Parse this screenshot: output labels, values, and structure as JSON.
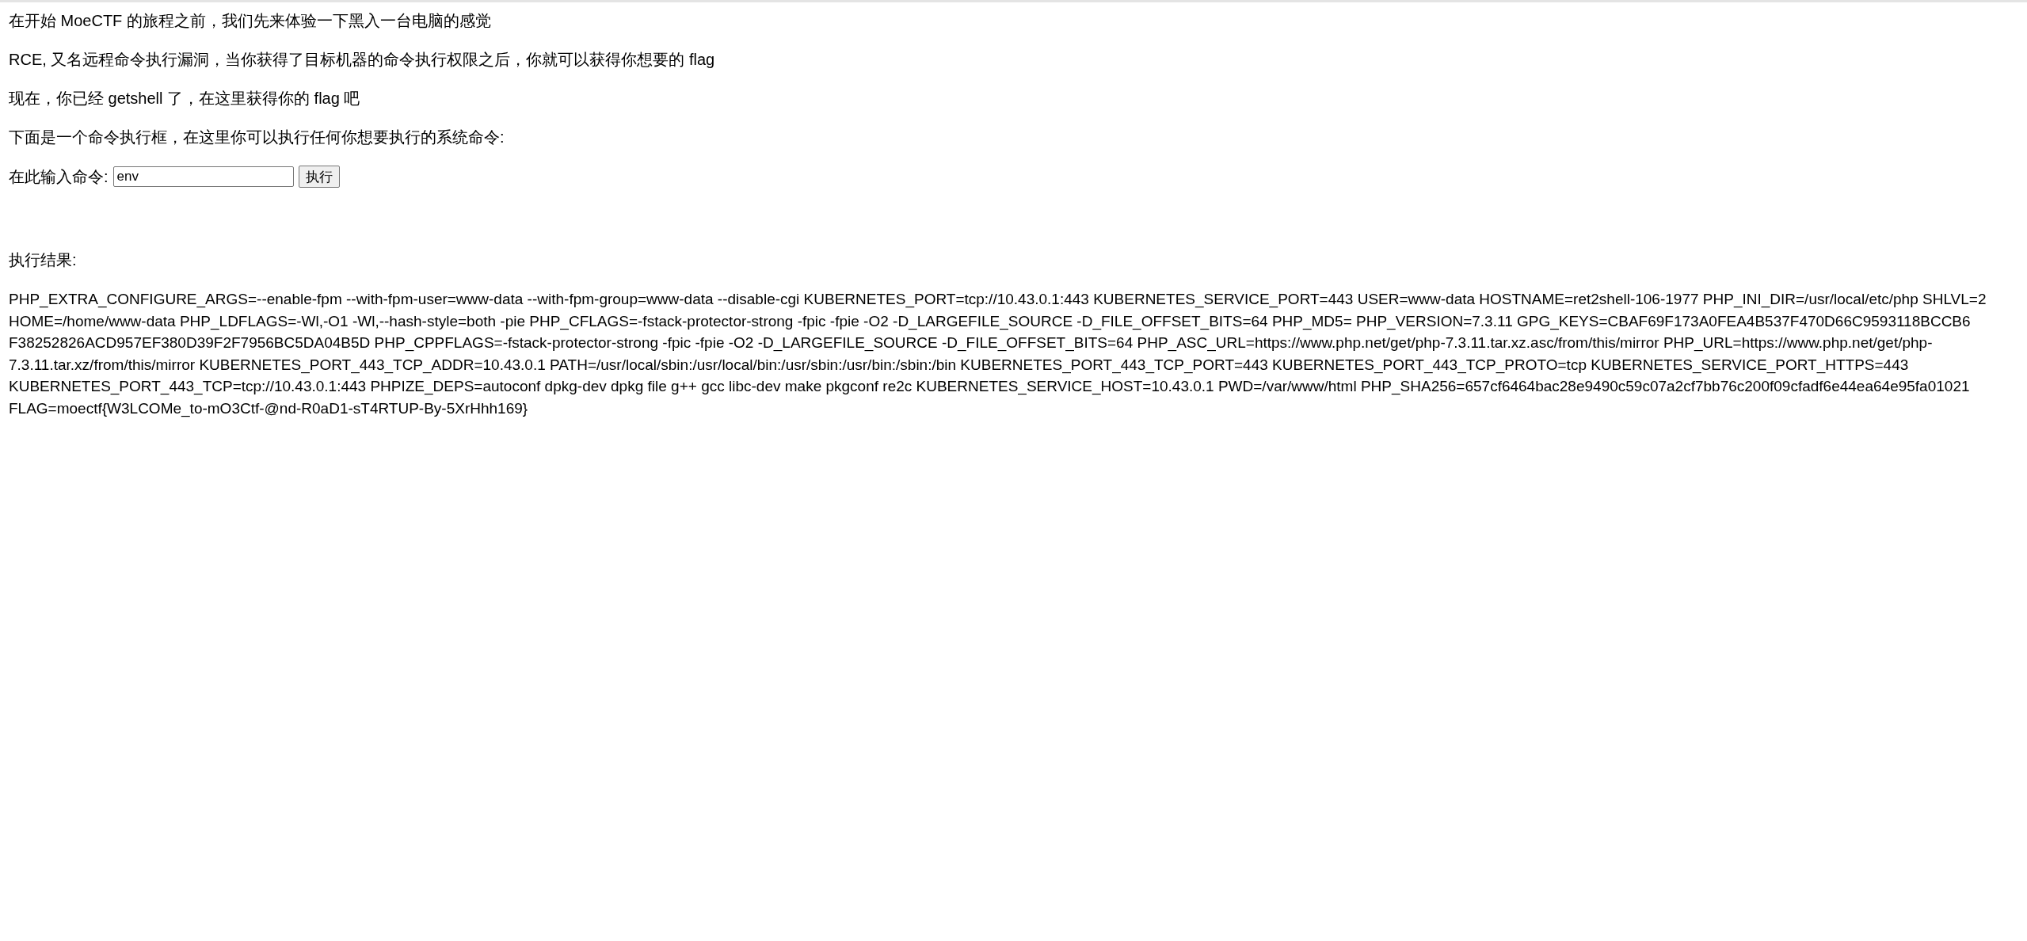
{
  "paragraphs": [
    "在开始 MoeCTF 的旅程之前，我们先来体验一下黑入一台电脑的感觉",
    "RCE, 又名远程命令执行漏洞，当你获得了目标机器的命令执行权限之后，你就可以获得你想要的 flag",
    "现在，你已经 getshell 了，在这里获得你的 flag 吧",
    "下面是一个命令执行框，在这里你可以执行任何你想要执行的系统命令:"
  ],
  "command_form": {
    "label": "在此输入命令:",
    "value": "env",
    "button": "执行"
  },
  "result": {
    "label": "执行结果:",
    "output": "PHP_EXTRA_CONFIGURE_ARGS=--enable-fpm --with-fpm-user=www-data --with-fpm-group=www-data --disable-cgi KUBERNETES_PORT=tcp://10.43.0.1:443 KUBERNETES_SERVICE_PORT=443 USER=www-data HOSTNAME=ret2shell-106-1977 PHP_INI_DIR=/usr/local/etc/php SHLVL=2 HOME=/home/www-data PHP_LDFLAGS=-Wl,-O1 -Wl,--hash-style=both -pie PHP_CFLAGS=-fstack-protector-strong -fpic -fpie -O2 -D_LARGEFILE_SOURCE -D_FILE_OFFSET_BITS=64 PHP_MD5= PHP_VERSION=7.3.11 GPG_KEYS=CBAF69F173A0FEA4B537F470D66C9593118BCCB6 F38252826ACD957EF380D39F2F7956BC5DA04B5D PHP_CPPFLAGS=-fstack-protector-strong -fpic -fpie -O2 -D_LARGEFILE_SOURCE -D_FILE_OFFSET_BITS=64 PHP_ASC_URL=https://www.php.net/get/php-7.3.11.tar.xz.asc/from/this/mirror PHP_URL=https://www.php.net/get/php-7.3.11.tar.xz/from/this/mirror KUBERNETES_PORT_443_TCP_ADDR=10.43.0.1 PATH=/usr/local/sbin:/usr/local/bin:/usr/sbin:/usr/bin:/sbin:/bin KUBERNETES_PORT_443_TCP_PORT=443 KUBERNETES_PORT_443_TCP_PROTO=tcp KUBERNETES_SERVICE_PORT_HTTPS=443 KUBERNETES_PORT_443_TCP=tcp://10.43.0.1:443 PHPIZE_DEPS=autoconf dpkg-dev dpkg file g++ gcc libc-dev make pkgconf re2c KUBERNETES_SERVICE_HOST=10.43.0.1 PWD=/var/www/html PHP_SHA256=657cf6464bac28e9490c59c07a2cf7bb76c200f09cfadf6e44ea64e95fa01021 FLAG=moectf{W3LCOMe_to-mO3Ctf-@nd-R0aD1-sT4RTUP-By-5XrHhh169}"
  }
}
